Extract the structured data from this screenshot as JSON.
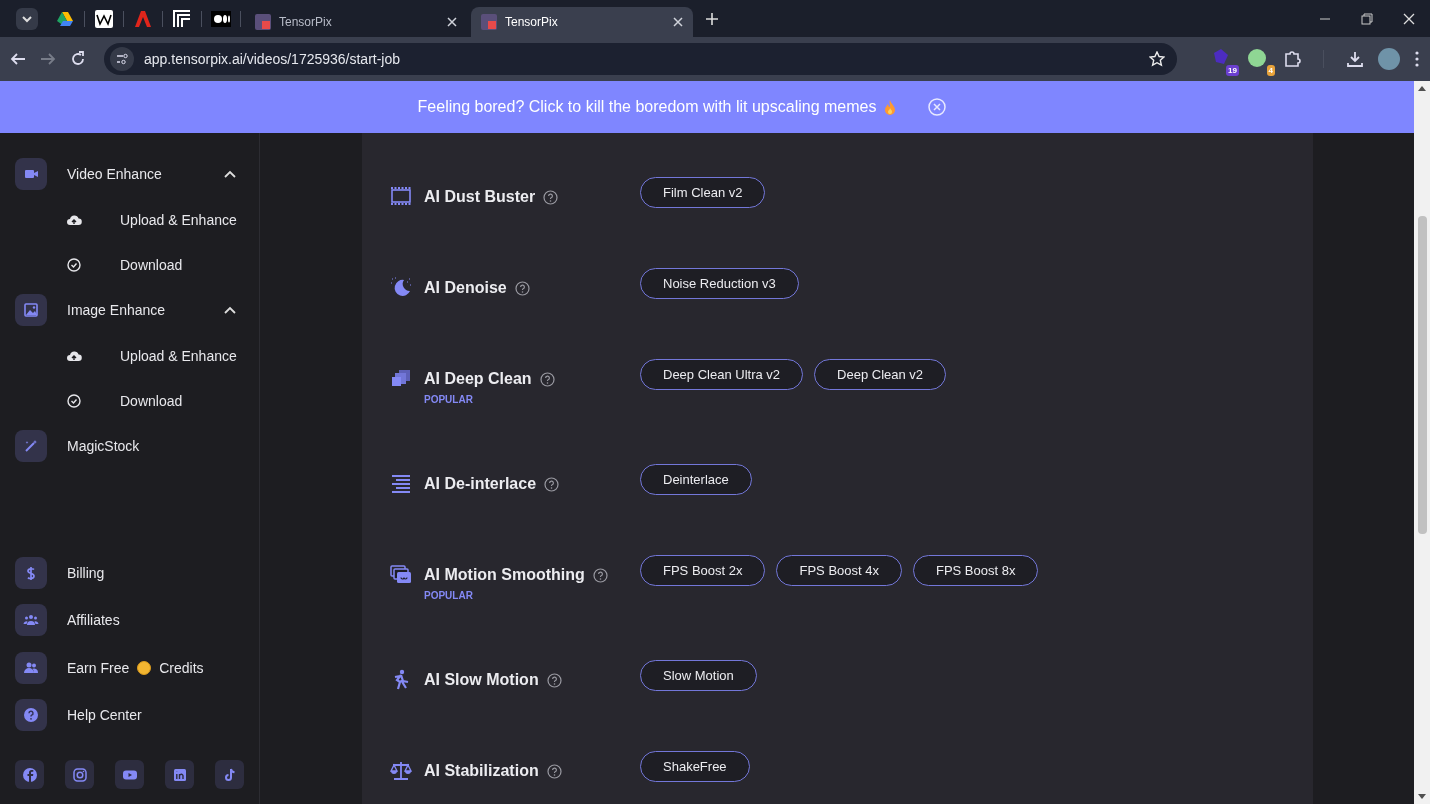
{
  "browser": {
    "tabs": [
      {
        "title": "TensorPix",
        "selected": false
      },
      {
        "title": "TensorPix",
        "selected": true
      }
    ],
    "address": "app.tensorpix.ai/videos/1725936/start-job",
    "extension_badges": [
      "19",
      "4"
    ]
  },
  "banner": {
    "text": "Feeling bored? Click to kill the boredom with lit upscaling memes"
  },
  "sidebar": {
    "groups": [
      {
        "label": "Video Enhance",
        "expanded": true,
        "children": [
          {
            "label": "Upload & Enhance"
          },
          {
            "label": "Download"
          }
        ]
      },
      {
        "label": "Image Enhance",
        "expanded": true,
        "children": [
          {
            "label": "Upload & Enhance"
          },
          {
            "label": "Download"
          }
        ]
      },
      {
        "label": "MagicStock"
      }
    ],
    "bottom_items": [
      {
        "label": "Billing"
      },
      {
        "label": "Affiliates"
      },
      {
        "label": "Earn Free",
        "label_after": "Credits"
      },
      {
        "label": "Help Center"
      }
    ]
  },
  "features": [
    {
      "name": "AI Dust Buster",
      "options": [
        "Film Clean v2"
      ]
    },
    {
      "name": "AI Denoise",
      "options": [
        "Noise Reduction v3"
      ]
    },
    {
      "name": "AI Deep Clean",
      "badge": "POPULAR",
      "options": [
        "Deep Clean Ultra v2",
        "Deep Clean v2"
      ]
    },
    {
      "name": "AI De-interlace",
      "options": [
        "Deinterlace"
      ]
    },
    {
      "name": "AI Motion Smoothing",
      "badge": "POPULAR",
      "options": [
        "FPS Boost 2x",
        "FPS Boost 4x",
        "FPS Boost 8x"
      ]
    },
    {
      "name": "AI Slow Motion",
      "options": [
        "Slow Motion"
      ]
    },
    {
      "name": "AI Stabilization",
      "options": [
        "ShakeFree"
      ]
    }
  ]
}
